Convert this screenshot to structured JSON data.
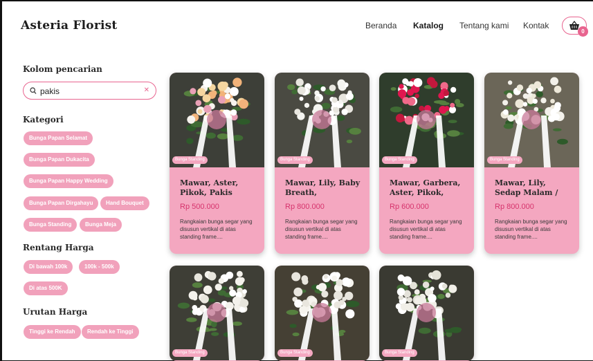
{
  "header": {
    "brand": "Asteria Florist",
    "nav": [
      "Beranda",
      "Katalog",
      "Tentang kami",
      "Kontak"
    ],
    "active_nav": "Katalog",
    "cart_count": "0",
    "cart_icon": "basket-icon"
  },
  "sidebar": {
    "search_title": "Kolom pencarian",
    "search_value": "pakis",
    "search_icon": "search-icon",
    "clear_icon": "close-icon",
    "category_title": "Kategori",
    "categories": [
      "Bunga Papan Selamat",
      "Bunga Papan Dukacita",
      "Bunga Papan Happy Wedding",
      "Bunga Papan Dirgahayu",
      "Hand Bouquet",
      "Bunga Standing",
      "Bunga Meja"
    ],
    "price_range_title": "Rentang Harga",
    "price_ranges": [
      "Di bawah 100k",
      "100k - 500k",
      "Di atas 500K"
    ],
    "sort_title": "Urutan Harga",
    "sorts": [
      "Tinggi ke Rendah",
      "Rendah ke Tinggi"
    ]
  },
  "products": [
    {
      "tag": "Bunga Standing",
      "title": "Mawar, Aster, Pikok, Pakis",
      "price": "Rp 500.000",
      "desc": "Rangkaian bunga segar yang disusun vertikal di atas standing frame...."
    },
    {
      "tag": "Bunga Standing",
      "title": "Mawar, Lily, Baby Breath, Snapdragon...",
      "price": "Rp 800.000",
      "desc": "Rangkaian bunga segar yang disusun vertikal di atas standing frame...."
    },
    {
      "tag": "Bunga Standing",
      "title": "Mawar, Garbera, Aster, Pikok, Daun...",
      "price": "Rp 600.000",
      "desc": "Rangkaian bunga segar yang disusun vertikal di atas standing frame...."
    },
    {
      "tag": "Bunga Standing",
      "title": "Mawar, Lily, Sedap Malam / Snapdrago...",
      "price": "Rp 800.000",
      "desc": "Rangkaian bunga segar yang disusun vertikal di atas standing frame...."
    },
    {
      "tag": "Bunga Standing",
      "title": "",
      "price": "",
      "desc": ""
    },
    {
      "tag": "Bunga Standing",
      "title": "",
      "price": "",
      "desc": ""
    },
    {
      "tag": "Bunga Standing",
      "title": "",
      "price": "",
      "desc": ""
    }
  ],
  "colors": {
    "accent": "#e8648f",
    "card": "#f4a7c0",
    "chip": "#f1a1bb",
    "price": "#d6336c"
  }
}
